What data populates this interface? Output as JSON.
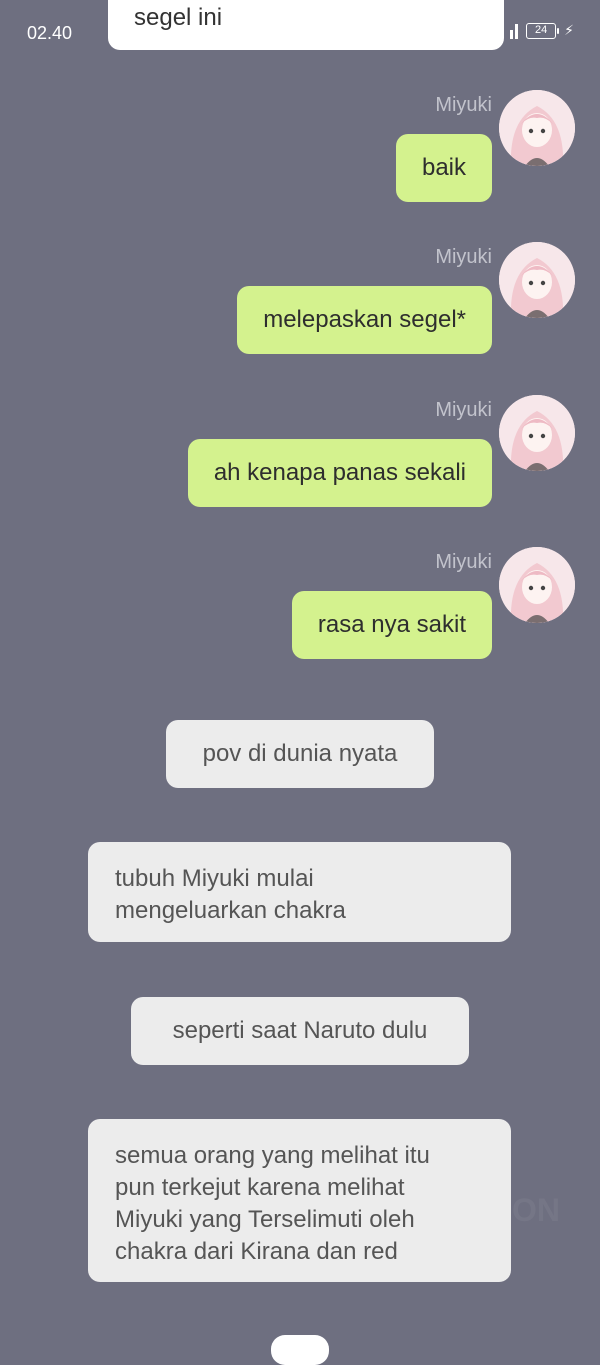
{
  "status_bar": {
    "time": "02.40",
    "battery": "24"
  },
  "top_partial_message": "segel ini",
  "messages": [
    {
      "name": "Miyuki",
      "text": "baik"
    },
    {
      "name": "Miyuki",
      "text": "melepaskan segel*"
    },
    {
      "name": "Miyuki",
      "text": "ah kenapa panas sekali"
    },
    {
      "name": "Miyuki",
      "text": "rasa nya sakit"
    }
  ],
  "narrations": [
    {
      "lines": [
        "pov di dunia nyata"
      ]
    },
    {
      "lines": [
        "tubuh Miyuki mulai",
        "mengeluarkan chakra"
      ]
    },
    {
      "lines": [
        "seperti saat Naruto dulu"
      ]
    },
    {
      "lines": [
        "semua orang yang melihat itu",
        "pun terkejut karena melihat",
        "Miyuki yang Terselimuti oleh",
        "chakra dari Kirana dan red"
      ]
    }
  ],
  "watermark": "ON",
  "colors": {
    "background": "#6e6f80",
    "sent_bubble": "#d4f28e",
    "narration_bubble": "#ececec",
    "name_text": "#c2c3cc"
  }
}
